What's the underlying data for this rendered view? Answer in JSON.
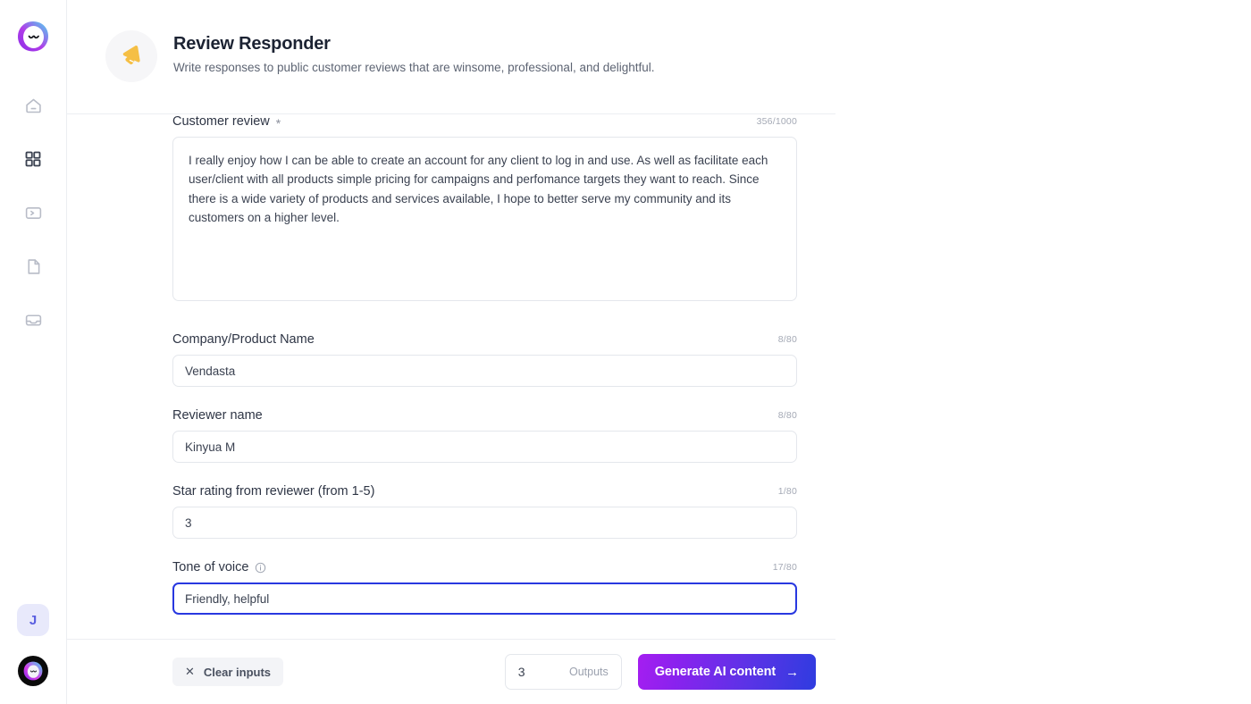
{
  "sidebar": {
    "brand": {
      "icon": "blob-logo"
    },
    "nav_items": [
      {
        "icon": "home-icon",
        "name": "home",
        "active": false
      },
      {
        "icon": "grid-apps-icon",
        "name": "apps",
        "active": true
      },
      {
        "icon": "terminal-icon",
        "name": "terminal",
        "active": false
      },
      {
        "icon": "document-icon",
        "name": "documents",
        "active": false
      },
      {
        "icon": "inbox-icon",
        "name": "inbox",
        "active": false
      }
    ],
    "avatar_initial": "J",
    "help_icon": "blob-help-icon"
  },
  "header": {
    "icon": "megaphone-icon",
    "title": "Review Responder",
    "subtitle": "Write responses to public customer reviews that are winsome, professional, and delightful."
  },
  "form": {
    "fields": [
      {
        "label": "Customer review",
        "required_marker": "*",
        "counter": "356/1000",
        "value": "I really enjoy how I can be able to create an account for any client to log in and use. As well as facilitate each user/client with all products simple pricing for campaigns and perfomance targets they want to reach. Since there is a wide variety of products and services available, I hope to better serve my community and its customers on a higher level.",
        "type": "textarea",
        "focused": false
      },
      {
        "label": "Company/Product Name",
        "counter": "8/80",
        "value": "Vendasta",
        "type": "text",
        "focused": false
      },
      {
        "label": "Reviewer name",
        "counter": "8/80",
        "value": "Kinyua M",
        "type": "text",
        "focused": false
      },
      {
        "label": "Star rating from reviewer (from 1-5)",
        "counter": "1/80",
        "value": "3",
        "type": "text",
        "focused": false
      },
      {
        "label": "Tone of voice",
        "counter": "17/80",
        "value": "Friendly, helpful",
        "type": "text",
        "focused": true,
        "info_icon": "info-circle-icon"
      }
    ]
  },
  "footer": {
    "clear_label": "Clear inputs",
    "clear_icon": "close-x-icon",
    "outputs_value": "3",
    "outputs_label": "Outputs",
    "generate_label": "Generate AI content",
    "generate_arrow": "→"
  },
  "colors": {
    "accent_purple": "#a51ef0",
    "accent_blue": "#2f3ce0",
    "focus_border": "#2838e0",
    "icon_yellow": "#f5bf45",
    "text_primary": "#1c2333",
    "text_secondary": "#5d6473",
    "border": "#e4e7ec"
  }
}
